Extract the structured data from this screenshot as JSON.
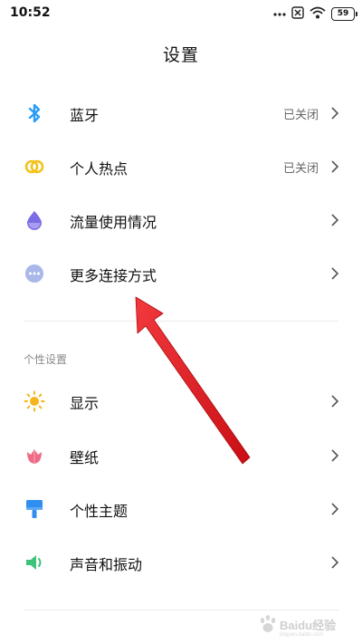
{
  "status_bar": {
    "time": "10:52",
    "battery": "59",
    "icons": [
      "dnd-x-icon",
      "sim-x-icon",
      "wifi-icon",
      "battery-icon"
    ]
  },
  "header": {
    "title": "设置"
  },
  "connection_items": [
    {
      "label": "蓝牙",
      "value": "已关闭",
      "icon": "bluetooth-icon",
      "color": "#2a9cf5"
    },
    {
      "label": "个人热点",
      "value": "已关闭",
      "icon": "hotspot-icon",
      "color": "#f2c21a"
    },
    {
      "label": "流量使用情况",
      "value": "",
      "icon": "data-usage-icon",
      "color": "#7b6de6"
    },
    {
      "label": "更多连接方式",
      "value": "",
      "icon": "more-connections-icon",
      "color": "#a9b8e8"
    }
  ],
  "personalization": {
    "header": "个性设置",
    "items": [
      {
        "label": "显示",
        "icon": "display-icon",
        "color": "#f5b51c"
      },
      {
        "label": "壁纸",
        "icon": "wallpaper-icon",
        "color": "#f06a86"
      },
      {
        "label": "个性主题",
        "icon": "theme-icon",
        "color": "#2f8ff0"
      },
      {
        "label": "声音和振动",
        "icon": "sound-icon",
        "color": "#3ec27a"
      }
    ]
  },
  "annotation": {
    "arrow_color": "#e8161c"
  },
  "watermark": {
    "text": "Baidu经验",
    "subtext": "jingyan.baidu.com"
  }
}
